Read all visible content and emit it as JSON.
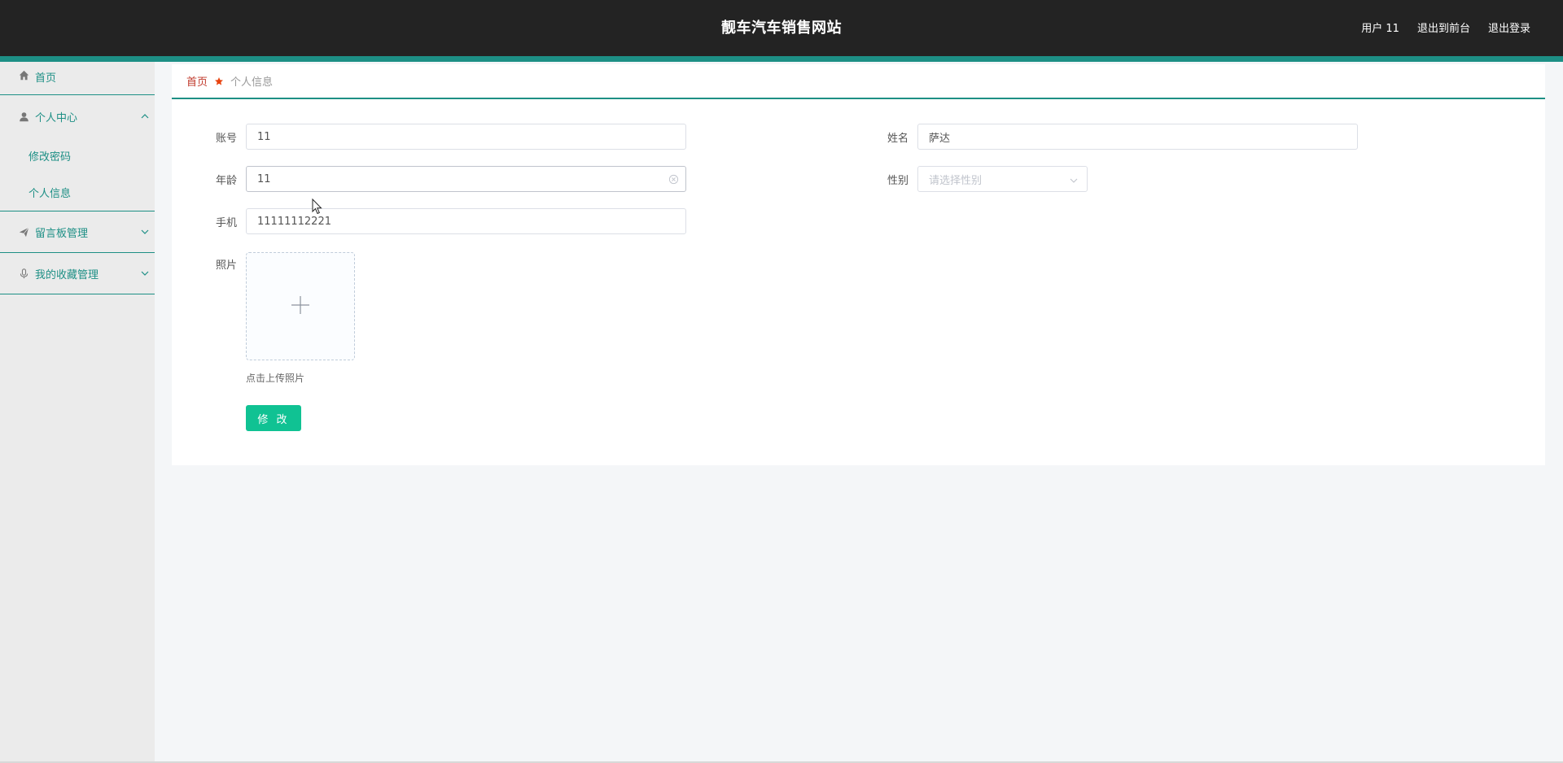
{
  "header": {
    "site_title": "靓车汽车销售网站",
    "user_label": "用户 11",
    "back_to_front": "退出到前台",
    "logout": "退出登录",
    "bg_color": "#232323",
    "accent_color": "#1d8f85"
  },
  "sidebar": {
    "home": "首页",
    "personal_center": "个人中心",
    "change_password": "修改密码",
    "personal_info": "个人信息",
    "message_board": "留言板管理",
    "favorites": "我的收藏管理"
  },
  "breadcrumb": {
    "home": "首页",
    "current": "个人信息"
  },
  "form": {
    "account_label": "账号",
    "account_value": "11",
    "name_label": "姓名",
    "name_value": "萨达",
    "age_label": "年龄",
    "age_value": "11",
    "gender_label": "性别",
    "gender_placeholder": "请选择性别",
    "phone_label": "手机",
    "phone_value": "11111112221",
    "photo_label": "照片",
    "upload_tip": "点击上传照片",
    "submit": "修 改",
    "submit_color": "#10c293"
  }
}
